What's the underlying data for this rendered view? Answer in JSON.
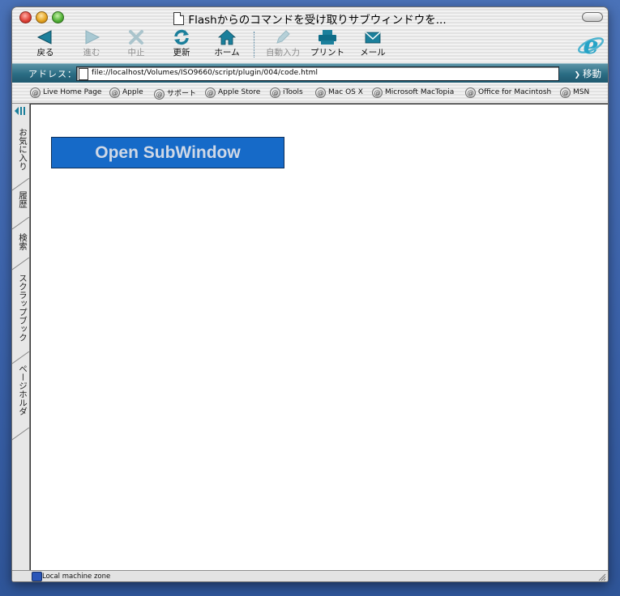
{
  "window": {
    "title": "Flashからのコマンドを受け取りサブウィンドウを..."
  },
  "toolbar": {
    "buttons": [
      {
        "label": "戻る",
        "icon": "back-arrow-icon",
        "enabled": true
      },
      {
        "label": "進む",
        "icon": "forward-arrow-icon",
        "enabled": false
      },
      {
        "label": "中止",
        "icon": "stop-x-icon",
        "enabled": false
      },
      {
        "label": "更新",
        "icon": "refresh-icon",
        "enabled": true
      },
      {
        "label": "ホーム",
        "icon": "home-icon",
        "enabled": true
      },
      {
        "label": "自動入力",
        "icon": "autofill-pen-icon",
        "enabled": false
      },
      {
        "label": "プリント",
        "icon": "printer-icon",
        "enabled": true
      },
      {
        "label": "メール",
        "icon": "mail-icon",
        "enabled": true
      }
    ]
  },
  "address": {
    "label": "アドレス：",
    "url": "file://localhost/Volumes/ISO9660/script/plugin/004/code.html",
    "go_label": "移動"
  },
  "favorites": [
    "Live Home Page",
    "Apple",
    "サポート",
    "Apple Store",
    "iTools",
    "Mac OS X",
    "Microsoft MacTopia",
    "Office for Macintosh",
    "MSN"
  ],
  "sidebar": {
    "tabs": [
      "お気に入り",
      "履歴",
      "検索",
      "スクラップブック",
      "ページホルダ"
    ]
  },
  "content": {
    "flash_button_label": "Open SubWindow"
  },
  "status": {
    "zone": "Local machine zone"
  },
  "colors": {
    "accent": "#2a6c83",
    "flash_button": "#166ac8",
    "desktop": "#3c63ab"
  }
}
